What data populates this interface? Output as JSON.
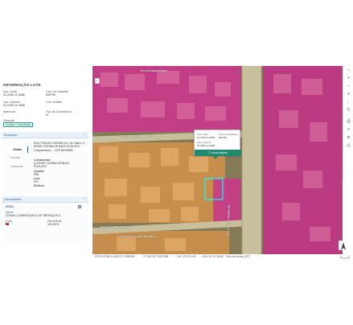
{
  "panel": {
    "title": "INFORMAÇÃO LOTE",
    "fields": [
      {
        "label": "Insc. Imob.",
        "value": "01.0153.11.0086"
      },
      {
        "label": "Cód. do Cadastro",
        "value": "839730"
      },
      {
        "label": "Insc. Anterior",
        "value": "01.0153.11.0086"
      },
      {
        "label": "Cód. Análise",
        "value": "-"
      },
      {
        "label": "Matrícula",
        "value": "-"
      },
      {
        "label": "Tipo do Condomínio",
        "value": "N"
      },
      {
        "label": "Situação",
        "value": "Quadra Consolidada"
      }
    ],
    "endereco": {
      "header": "Endereço",
      "tab_label": "Global",
      "side_labels": [
        "Corresp.",
        "Comercial"
      ],
      "address": "RUA TORILDO VERMELHO, 84, Bairro Cj RESID CORINA DE BIAGI PUGLIESI, Complemento: -, CEP 86706580",
      "fields": [
        {
          "label": "Loteamento",
          "value": "Cj RESID CORINA DE BIAGI PUGLIESI"
        },
        {
          "label": "Quadra",
          "value": "008"
        },
        {
          "label": "Lote",
          "value": "007"
        },
        {
          "label": "Edifício",
          "value": ""
        }
      ]
    },
    "zoneamento": {
      "header": "Zoneamento",
      "code": "ZCS3",
      "nome_label": "Nome",
      "nome_value": "ZONAS COMERCIAIS E DE SERVIÇOS 3",
      "cota_label": "Cota",
      "cota_value": "",
      "perc_label": "Percentual",
      "perc_value": "100,00%"
    }
  },
  "map": {
    "popup": {
      "f1_label": "Insc. Imob.",
      "f1_value": "01.0153.11.0086",
      "f2_label": "Cód. do Cadastro",
      "f2_value": "839730",
      "f3_label": "Insc. Anterior",
      "f3_value": "01.0153.11.0086",
      "button": "Informações"
    },
    "streets": [
      "RUA TORILDO VERMELHO",
      "RUA ALBA CORINA MOREIRA",
      "RUA ORLANDO SANCHES",
      "RUA TORILDO VERMELHO",
      "RUA PALMEIRA MARIA"
    ],
    "status": {
      "epsg": "EPSG:31982",
      "x": "X:481871,71655491",
      "y": "Y:7420741,75257088",
      "lat": "LAT:-23°20'4.05\"",
      "lon": "LON:-51°12'48.86\"",
      "hint": "Role do mouse (ZP)"
    },
    "colors": {
      "lot_magenta": "#cc3a8a",
      "lot_orange": "#d89447",
      "road": "#c9c1a0",
      "accent": "#1f8a70"
    }
  }
}
